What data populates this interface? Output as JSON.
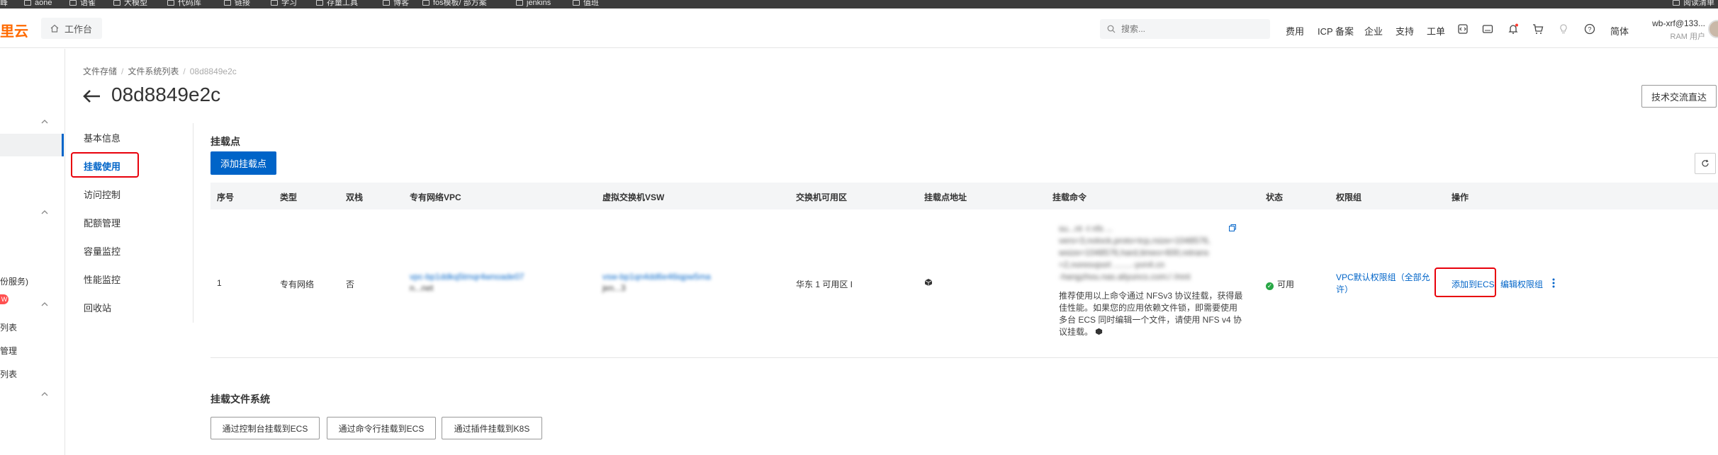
{
  "bookmarks": [
    {
      "label": "峰",
      "x_hint": "a"
    },
    {
      "label": "aone"
    },
    {
      "label": "语雀"
    },
    {
      "label": "大模型"
    },
    {
      "label": "代码库"
    },
    {
      "label": "链接"
    },
    {
      "label": "学习"
    },
    {
      "label": "存量工具"
    },
    {
      "label": "博客"
    },
    {
      "label": "fos模板/ 部方案"
    },
    {
      "label": "jenkins"
    },
    {
      "label": "值班"
    },
    {
      "label": "阅读清单"
    }
  ],
  "topbar": {
    "brand": "里云",
    "workbench_label": "工作台",
    "search_placeholder": "搜索...",
    "nav_links": [
      "费用",
      "ICP 备案",
      "企业",
      "支持",
      "工单"
    ],
    "lang_label": "简体",
    "user_name": "wb-xrf@133...",
    "user_role": "RAM 用户"
  },
  "left_menu": {
    "items": [
      "份服务)",
      "列表",
      "管理",
      "列表"
    ],
    "badge": "W"
  },
  "breadcrumb": [
    "文件存储",
    "文件系统列表",
    "08d8849e2c"
  ],
  "page_title": "08d8849e2c",
  "tech_button": "技术交流直达",
  "subnav": [
    "基本信息",
    "挂载使用",
    "访问控制",
    "配额管理",
    "容量监控",
    "性能监控",
    "回收站"
  ],
  "subnav_active": "挂载使用",
  "mount_points": {
    "title": "挂载点",
    "add_button": "添加挂载点",
    "columns": [
      "序号",
      "类型",
      "双栈",
      "专有网络VPC",
      "虚拟交换机VSW",
      "交换机可用区",
      "挂载点地址",
      "挂载命令",
      "状态",
      "权限组",
      "操作"
    ],
    "rows": [
      {
        "index": "1",
        "type": "专有网络",
        "dual_stack": "否",
        "vpc_id": "vpc-bp1ddkq5tmqr4wnoade07",
        "vpc_name": "n...net",
        "vsw_id": "vsw-bp1qn4dd6e46iqpw5ma",
        "vsw_name": "jen...3",
        "zone": "华东 1 可用区 I",
        "mount_command_lines": [
          "su...nt -t nfs ...",
          "vers=3,nolock,proto=tcp,rsize=1048576,",
          "wsize=1048576,hard,timeo=600,retrans",
          "=2,noresvport ........-yvn4.cn",
          "-hangzhou.nas.aliyuncs.com:/ /mnt"
        ],
        "mount_command_note": "推荐使用以上命令通过 NFSv3 协议挂载，获得最佳性能。如果您的应用依赖文件锁，即需要使用多台 ECS 同时编辑一个文件，请使用 NFS v4 协议挂载。",
        "status": "可用",
        "permission_group": "VPC默认权限组（全部允许）",
        "actions": [
          "添加到ECS",
          "编辑权限组"
        ]
      }
    ]
  },
  "mount_fs": {
    "title": "挂载文件系统",
    "buttons": [
      "通过控制台挂载到ECS",
      "通过命令行挂载到ECS",
      "通过插件挂载到K8S"
    ]
  },
  "colors": {
    "accent": "#0064c8",
    "highlight": "#e8000b",
    "brand": "#ff6a00",
    "ok": "#28a745"
  }
}
